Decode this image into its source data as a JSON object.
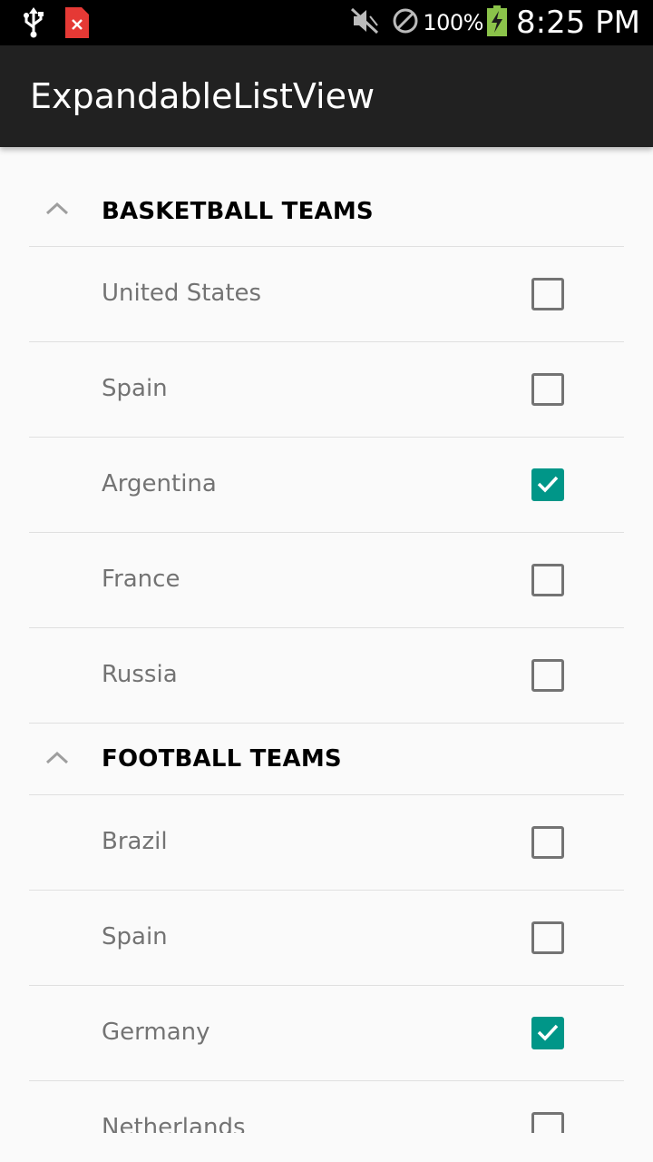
{
  "status_bar": {
    "battery_percent": "100%",
    "time": "8:25 PM",
    "icons": [
      "usb-icon",
      "error-file-icon",
      "mute-vibrate-icon",
      "blocked-icon",
      "battery-charging-icon"
    ]
  },
  "app_bar": {
    "title": "ExpandableListView"
  },
  "groups": [
    {
      "label": "BASKETBALL TEAMS",
      "expanded": true,
      "items": [
        {
          "label": "United States",
          "checked": false
        },
        {
          "label": "Spain",
          "checked": false
        },
        {
          "label": "Argentina",
          "checked": true
        },
        {
          "label": "France",
          "checked": false
        },
        {
          "label": "Russia",
          "checked": false
        }
      ]
    },
    {
      "label": "FOOTBALL TEAMS",
      "expanded": true,
      "items": [
        {
          "label": "Brazil",
          "checked": false
        },
        {
          "label": "Spain",
          "checked": false
        },
        {
          "label": "Germany",
          "checked": true
        },
        {
          "label": "Netherlands",
          "checked": false
        }
      ]
    }
  ],
  "colors": {
    "accent": "#009688",
    "app_bar": "#212121",
    "status_bar": "#000000",
    "background": "#fafafa"
  }
}
